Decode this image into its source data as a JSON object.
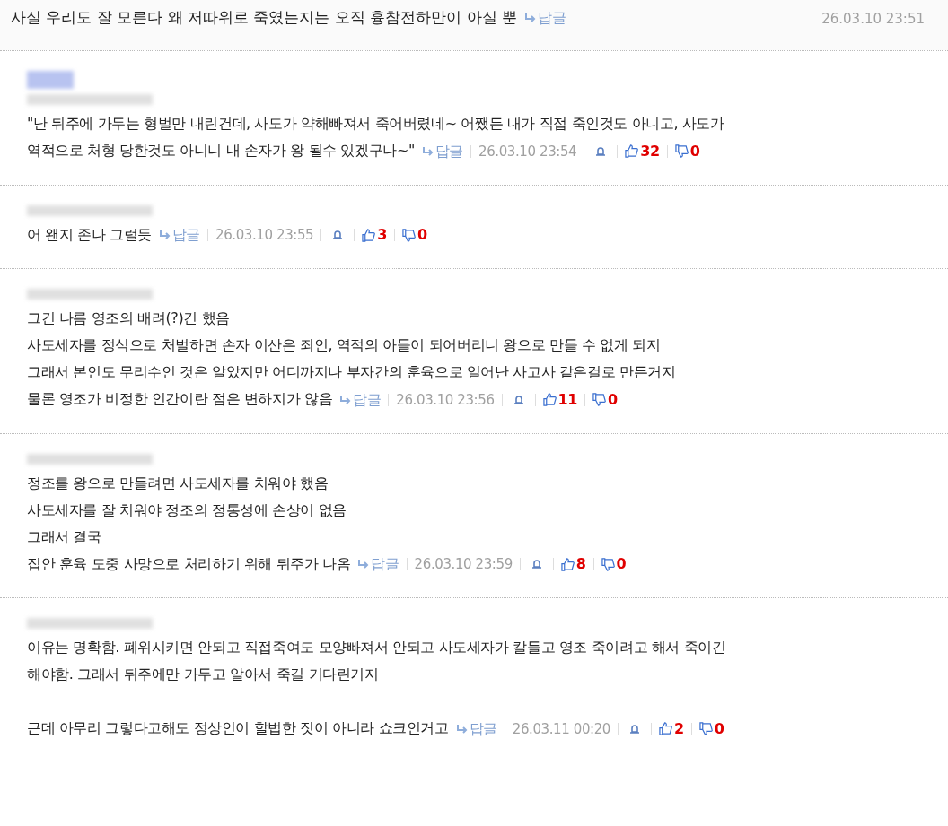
{
  "top_comment": {
    "text": "사실 우리도 잘 모른다 왜 저따위로 죽였는지는 오직 흉참전하만이 아실 뿐",
    "reply": "답글",
    "date": "26.03.10 23:51"
  },
  "comments": [
    {
      "avatar": true,
      "paragraphs": [
        [
          "\"난 뒤주에 가두는 형벌만 내린건데, 사도가 약해빠져서 죽어버렸네~ 어쨌든 내가 직접 죽인것도 아니고, 사도가",
          "역적으로 처형 당한것도 아니니 내 손자가 왕 될수 있겠구나~\""
        ]
      ],
      "reply": "답글",
      "date": "26.03.10 23:54",
      "likes": "32",
      "dislikes": "0"
    },
    {
      "avatar": false,
      "paragraphs": [
        [
          "어 왠지 존나 그럴듯"
        ]
      ],
      "reply": "답글",
      "date": "26.03.10 23:55",
      "likes": "3",
      "dislikes": "0"
    },
    {
      "avatar": false,
      "paragraphs": [
        [
          "그건 나름 영조의 배려(?)긴 했음",
          "사도세자를 정식으로 처벌하면 손자 이산은 죄인, 역적의 아들이 되어버리니 왕으로 만들 수 없게 되지",
          "그래서 본인도 무리수인 것은 알았지만 어디까지나 부자간의 훈육으로 일어난 사고사 같은걸로 만든거지",
          "물론 영조가 비정한 인간이란 점은 변하지가 않음"
        ]
      ],
      "reply": "답글",
      "date": "26.03.10 23:56",
      "likes": "11",
      "dislikes": "0"
    },
    {
      "avatar": false,
      "paragraphs": [
        [
          "정조를 왕으로 만들려면 사도세자를 치워야 했음",
          "사도세자를 잘 치워야 정조의 정통성에 손상이 없음",
          "그래서 결국",
          "집안 훈육 도중 사망으로 처리하기 위해 뒤주가 나옴"
        ]
      ],
      "reply": "답글",
      "date": "26.03.10 23:59",
      "likes": "8",
      "dislikes": "0"
    },
    {
      "avatar": false,
      "paragraphs": [
        [
          "이유는 명확함. 폐위시키면 안되고 직접죽여도 모양빠져서 안되고 사도세자가 칼들고 영조 죽이려고 해서 죽이긴",
          "해야함. 그래서 뒤주에만 가두고 알아서 죽길 기다린거지"
        ],
        [
          "근데 아무리 그렇다고해도 정상인이 할법한 짓이 아니라 쇼크인거고"
        ]
      ],
      "reply": "답글",
      "date": "26.03.11 00:20",
      "likes": "2",
      "dislikes": "0"
    }
  ]
}
